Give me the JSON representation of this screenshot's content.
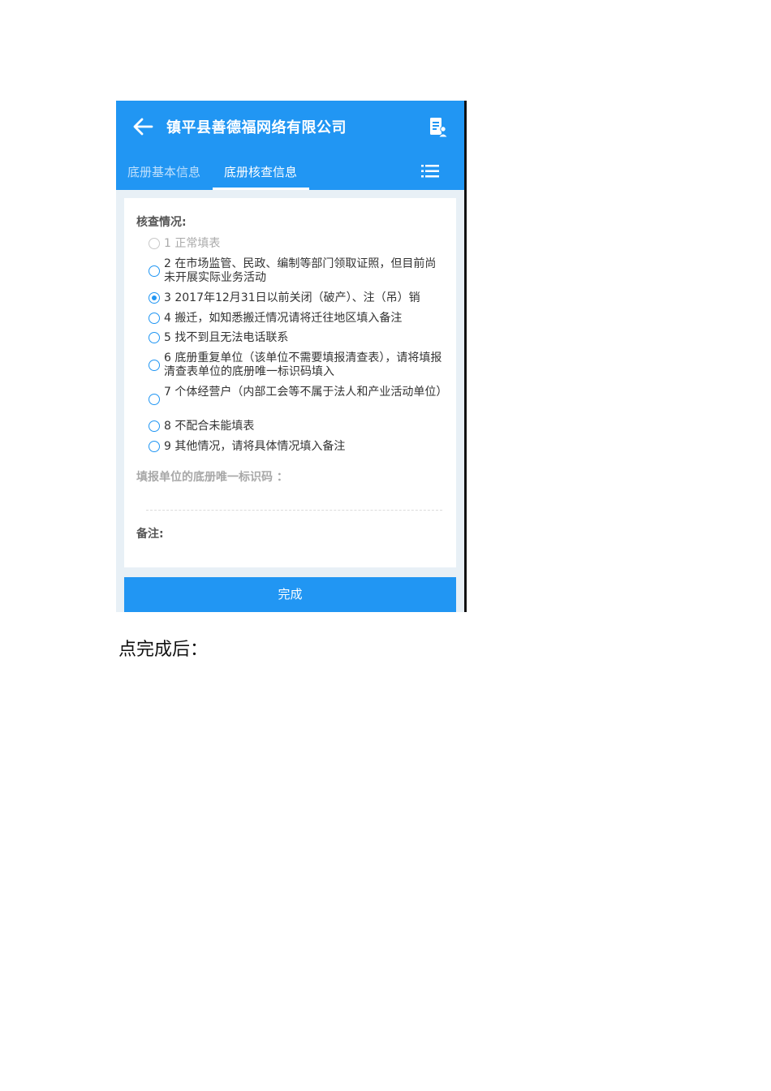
{
  "app": {
    "title": "镇平县善德福网络有限公司",
    "tabs": [
      "底册基本信息",
      "底册核查信息"
    ],
    "active_tab": 1,
    "accent_color": "#2196f3",
    "icons": {
      "back": "arrow-left-icon",
      "doc": "document-person-icon",
      "menu": "list-menu-icon"
    }
  },
  "form": {
    "check_label": "核查情况:",
    "options": [
      {
        "text": "1 正常填表",
        "state": "disabled"
      },
      {
        "text": "2 在市场监管、民政、编制等部门领取证照，但目前尚未开展实际业务活动",
        "state": "unchecked"
      },
      {
        "text": "3 2017年12月31日以前关闭（破产）、注（吊）销",
        "state": "checked"
      },
      {
        "text": "4 搬迁，如知悉搬迁情况请将迁往地区填入备注",
        "state": "unchecked"
      },
      {
        "text": "5 找不到且无法电话联系",
        "state": "unchecked"
      },
      {
        "text": "6 底册重复单位（该单位不需要填报清查表），请将填报清查表单位的底册唯一标识码填入",
        "state": "unchecked"
      },
      {
        "text": "7 个体经营户（内部工会等不属于法人和产业活动单位）",
        "state": "unchecked"
      },
      {
        "text": "8 不配合未能填表",
        "state": "unchecked"
      },
      {
        "text": "9 其他情况，请将具体情况填入备注",
        "state": "unchecked"
      }
    ],
    "id_label": "填报单位的底册唯一标识码 ：",
    "note_label": "备注:",
    "done_label": "完成"
  },
  "caption": "点完成后："
}
